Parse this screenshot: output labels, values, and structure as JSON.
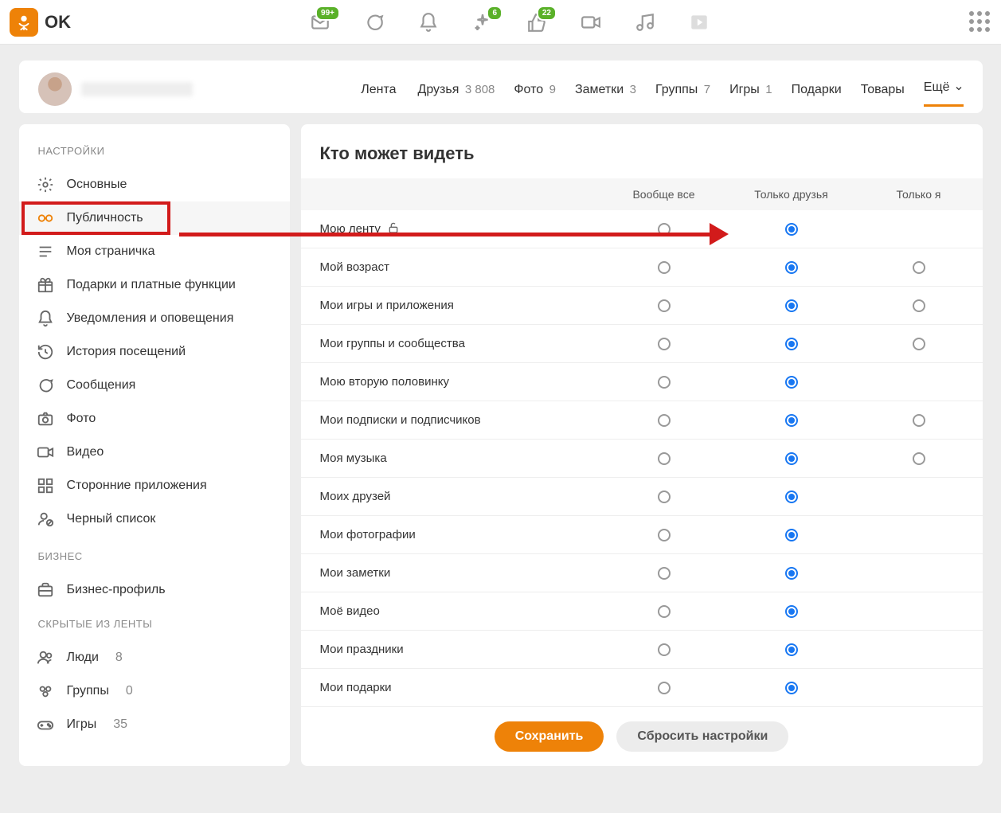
{
  "brand": "OK",
  "top_badges": {
    "messages": "99+",
    "discussions": "6",
    "likes": "22"
  },
  "profile_tabs": [
    {
      "label": "Лента",
      "count": ""
    },
    {
      "label": "Друзья",
      "count": "3 808"
    },
    {
      "label": "Фото",
      "count": "9"
    },
    {
      "label": "Заметки",
      "count": "3"
    },
    {
      "label": "Группы",
      "count": "7"
    },
    {
      "label": "Игры",
      "count": "1"
    },
    {
      "label": "Подарки",
      "count": ""
    },
    {
      "label": "Товары",
      "count": ""
    }
  ],
  "more_label": "Ещё",
  "sidebar": {
    "heading_settings": "НАСТРОЙКИ",
    "heading_business": "БИЗНЕС",
    "heading_hidden": "СКРЫТЫЕ ИЗ ЛЕНТЫ",
    "items": [
      {
        "label": "Основные",
        "count": ""
      },
      {
        "label": "Публичность",
        "count": ""
      },
      {
        "label": "Моя страничка",
        "count": ""
      },
      {
        "label": "Подарки и платные функции",
        "count": ""
      },
      {
        "label": "Уведомления и оповещения",
        "count": ""
      },
      {
        "label": "История посещений",
        "count": ""
      },
      {
        "label": "Сообщения",
        "count": ""
      },
      {
        "label": "Фото",
        "count": ""
      },
      {
        "label": "Видео",
        "count": ""
      },
      {
        "label": "Сторонние приложения",
        "count": ""
      },
      {
        "label": "Черный список",
        "count": ""
      }
    ],
    "business": [
      {
        "label": "Бизнес-профиль",
        "count": ""
      }
    ],
    "hidden": [
      {
        "label": "Люди",
        "count": "8"
      },
      {
        "label": "Группы",
        "count": "0"
      },
      {
        "label": "Игры",
        "count": "35"
      }
    ]
  },
  "privacy": {
    "title": "Кто может видеть",
    "columns": [
      "Вообще все",
      "Только друзья",
      "Только я"
    ],
    "rows": [
      {
        "label": "Мою ленту",
        "lock": true,
        "selected": 1,
        "opts": [
          true,
          true,
          false
        ]
      },
      {
        "label": "Мой возраст",
        "lock": false,
        "selected": 1,
        "opts": [
          true,
          true,
          true
        ]
      },
      {
        "label": "Мои игры и приложения",
        "lock": false,
        "selected": 1,
        "opts": [
          true,
          true,
          true
        ]
      },
      {
        "label": "Мои группы и сообщества",
        "lock": false,
        "selected": 1,
        "opts": [
          true,
          true,
          true
        ]
      },
      {
        "label": "Мою вторую половинку",
        "lock": false,
        "selected": 1,
        "opts": [
          true,
          true,
          false
        ]
      },
      {
        "label": "Мои подписки и подписчиков",
        "lock": false,
        "selected": 1,
        "opts": [
          true,
          true,
          true
        ]
      },
      {
        "label": "Моя музыка",
        "lock": false,
        "selected": 1,
        "opts": [
          true,
          true,
          true
        ]
      },
      {
        "label": "Моих друзей",
        "lock": false,
        "selected": 1,
        "opts": [
          true,
          true,
          false
        ]
      },
      {
        "label": "Мои фотографии",
        "lock": false,
        "selected": 1,
        "opts": [
          true,
          true,
          false
        ]
      },
      {
        "label": "Мои заметки",
        "lock": false,
        "selected": 1,
        "opts": [
          true,
          true,
          false
        ]
      },
      {
        "label": "Моё видео",
        "lock": false,
        "selected": 1,
        "opts": [
          true,
          true,
          false
        ]
      },
      {
        "label": "Мои праздники",
        "lock": false,
        "selected": 1,
        "opts": [
          true,
          true,
          false
        ]
      },
      {
        "label": "Мои подарки",
        "lock": false,
        "selected": 1,
        "opts": [
          true,
          true,
          false
        ]
      }
    ],
    "save": "Сохранить",
    "reset": "Сбросить настройки"
  },
  "annotation": {
    "highlight_sidebar_index": 1,
    "highlight_column_index": 1,
    "arrow": true
  }
}
